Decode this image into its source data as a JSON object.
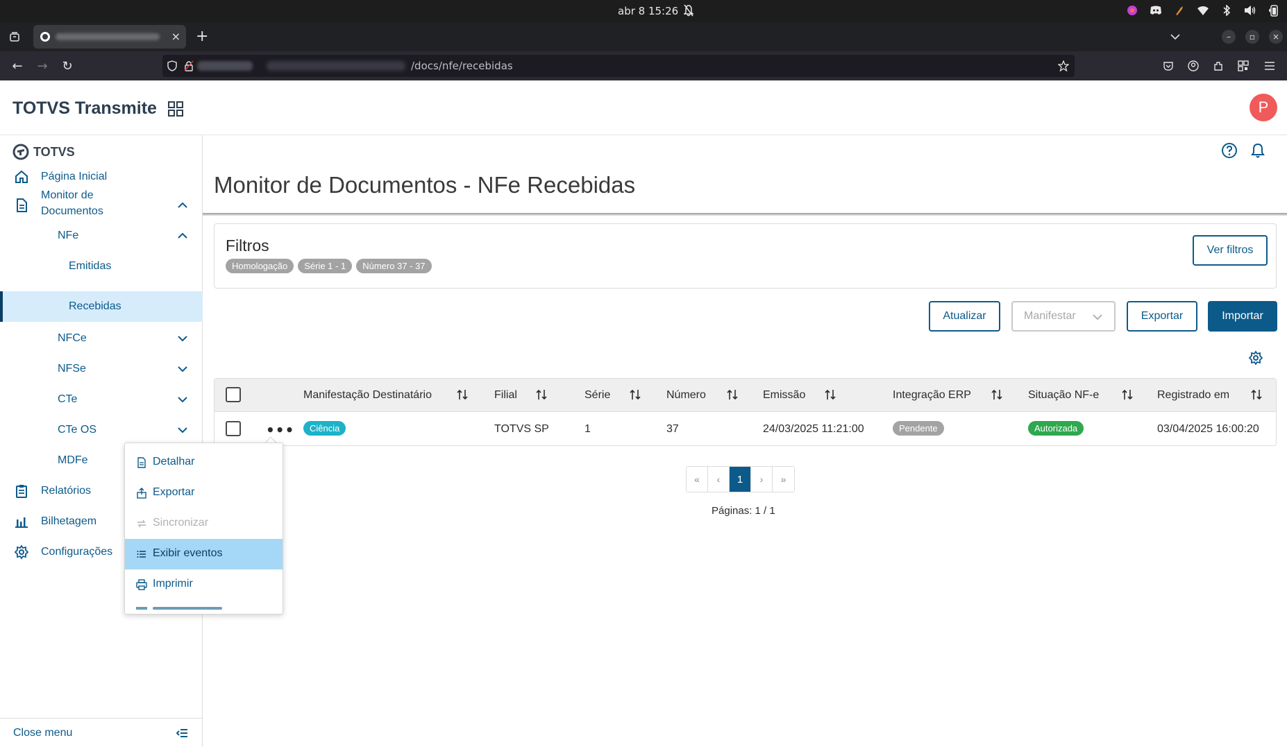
{
  "os": {
    "clock": "abr 8  15:26"
  },
  "browser": {
    "url_path": "/docs/nfe/recebidas"
  },
  "app": {
    "title": "TOTVS Transmite",
    "avatar_letter": "P"
  },
  "sidebar": {
    "brand": "TOTVS",
    "items": [
      {
        "label": "Página Inicial",
        "icon": "home-icon"
      },
      {
        "label": "Monitor de",
        "label2": "Documentos",
        "icon": "document-icon"
      },
      {
        "label": "NFe"
      },
      {
        "label": "Emitidas"
      },
      {
        "label": "Recebidas"
      },
      {
        "label": "NFCe"
      },
      {
        "label": "NFSe"
      },
      {
        "label": "CTe"
      },
      {
        "label": "CTe OS"
      },
      {
        "label": "MDFe"
      },
      {
        "label": "Relatórios",
        "icon": "clipboard-icon"
      },
      {
        "label": "Bilhetagem",
        "icon": "bar-chart-icon"
      },
      {
        "label": "Configurações",
        "icon": "gear-icon"
      }
    ],
    "close_menu": "Close menu"
  },
  "page": {
    "title": "Monitor de Documentos - NFe Recebidas"
  },
  "filters": {
    "title": "Filtros",
    "chips": [
      "Homologação",
      "Série 1 - 1",
      "Número 37 - 37"
    ],
    "view_button": "Ver filtros"
  },
  "actions": {
    "refresh": "Atualizar",
    "manifest": "Manifestar",
    "export": "Exportar",
    "import": "Importar"
  },
  "table": {
    "columns": [
      "Manifestação Destinatário",
      "Filial",
      "Série",
      "Número",
      "Emissão",
      "Integração ERP",
      "Situação NF-e",
      "Registrado em"
    ],
    "rows": [
      {
        "manifestacao": "Ciência",
        "filial": "TOTVS SP",
        "serie": "1",
        "numero": "37",
        "emissao": "24/03/2025 11:21:00",
        "integracao": "Pendente",
        "situacao": "Autorizada",
        "registrado": "03/04/2025 16:00:20"
      }
    ]
  },
  "pagination": {
    "first": "«",
    "prev": "‹",
    "current": "1",
    "next": "›",
    "last": "»",
    "label": "Páginas: 1 / 1"
  },
  "row_menu": {
    "items": [
      {
        "label": "Detalhar",
        "icon": "document-icon",
        "state": "normal"
      },
      {
        "label": "Exportar",
        "icon": "export-icon",
        "state": "normal"
      },
      {
        "label": "Sincronizar",
        "icon": "sync-icon",
        "state": "disabled"
      },
      {
        "label": "Exibir eventos",
        "icon": "list-icon",
        "state": "hover"
      },
      {
        "label": "Imprimir",
        "icon": "printer-icon",
        "state": "normal"
      }
    ]
  },
  "colors": {
    "primary": "#0c5a8a",
    "tag_ciencia": "#1cb3c8",
    "tag_pendente": "#a3a3a3",
    "tag_autorizada": "#2fa84f",
    "active_menu_bg": "#d6ecfb",
    "hover_menu_bg": "#a5d7f7"
  }
}
